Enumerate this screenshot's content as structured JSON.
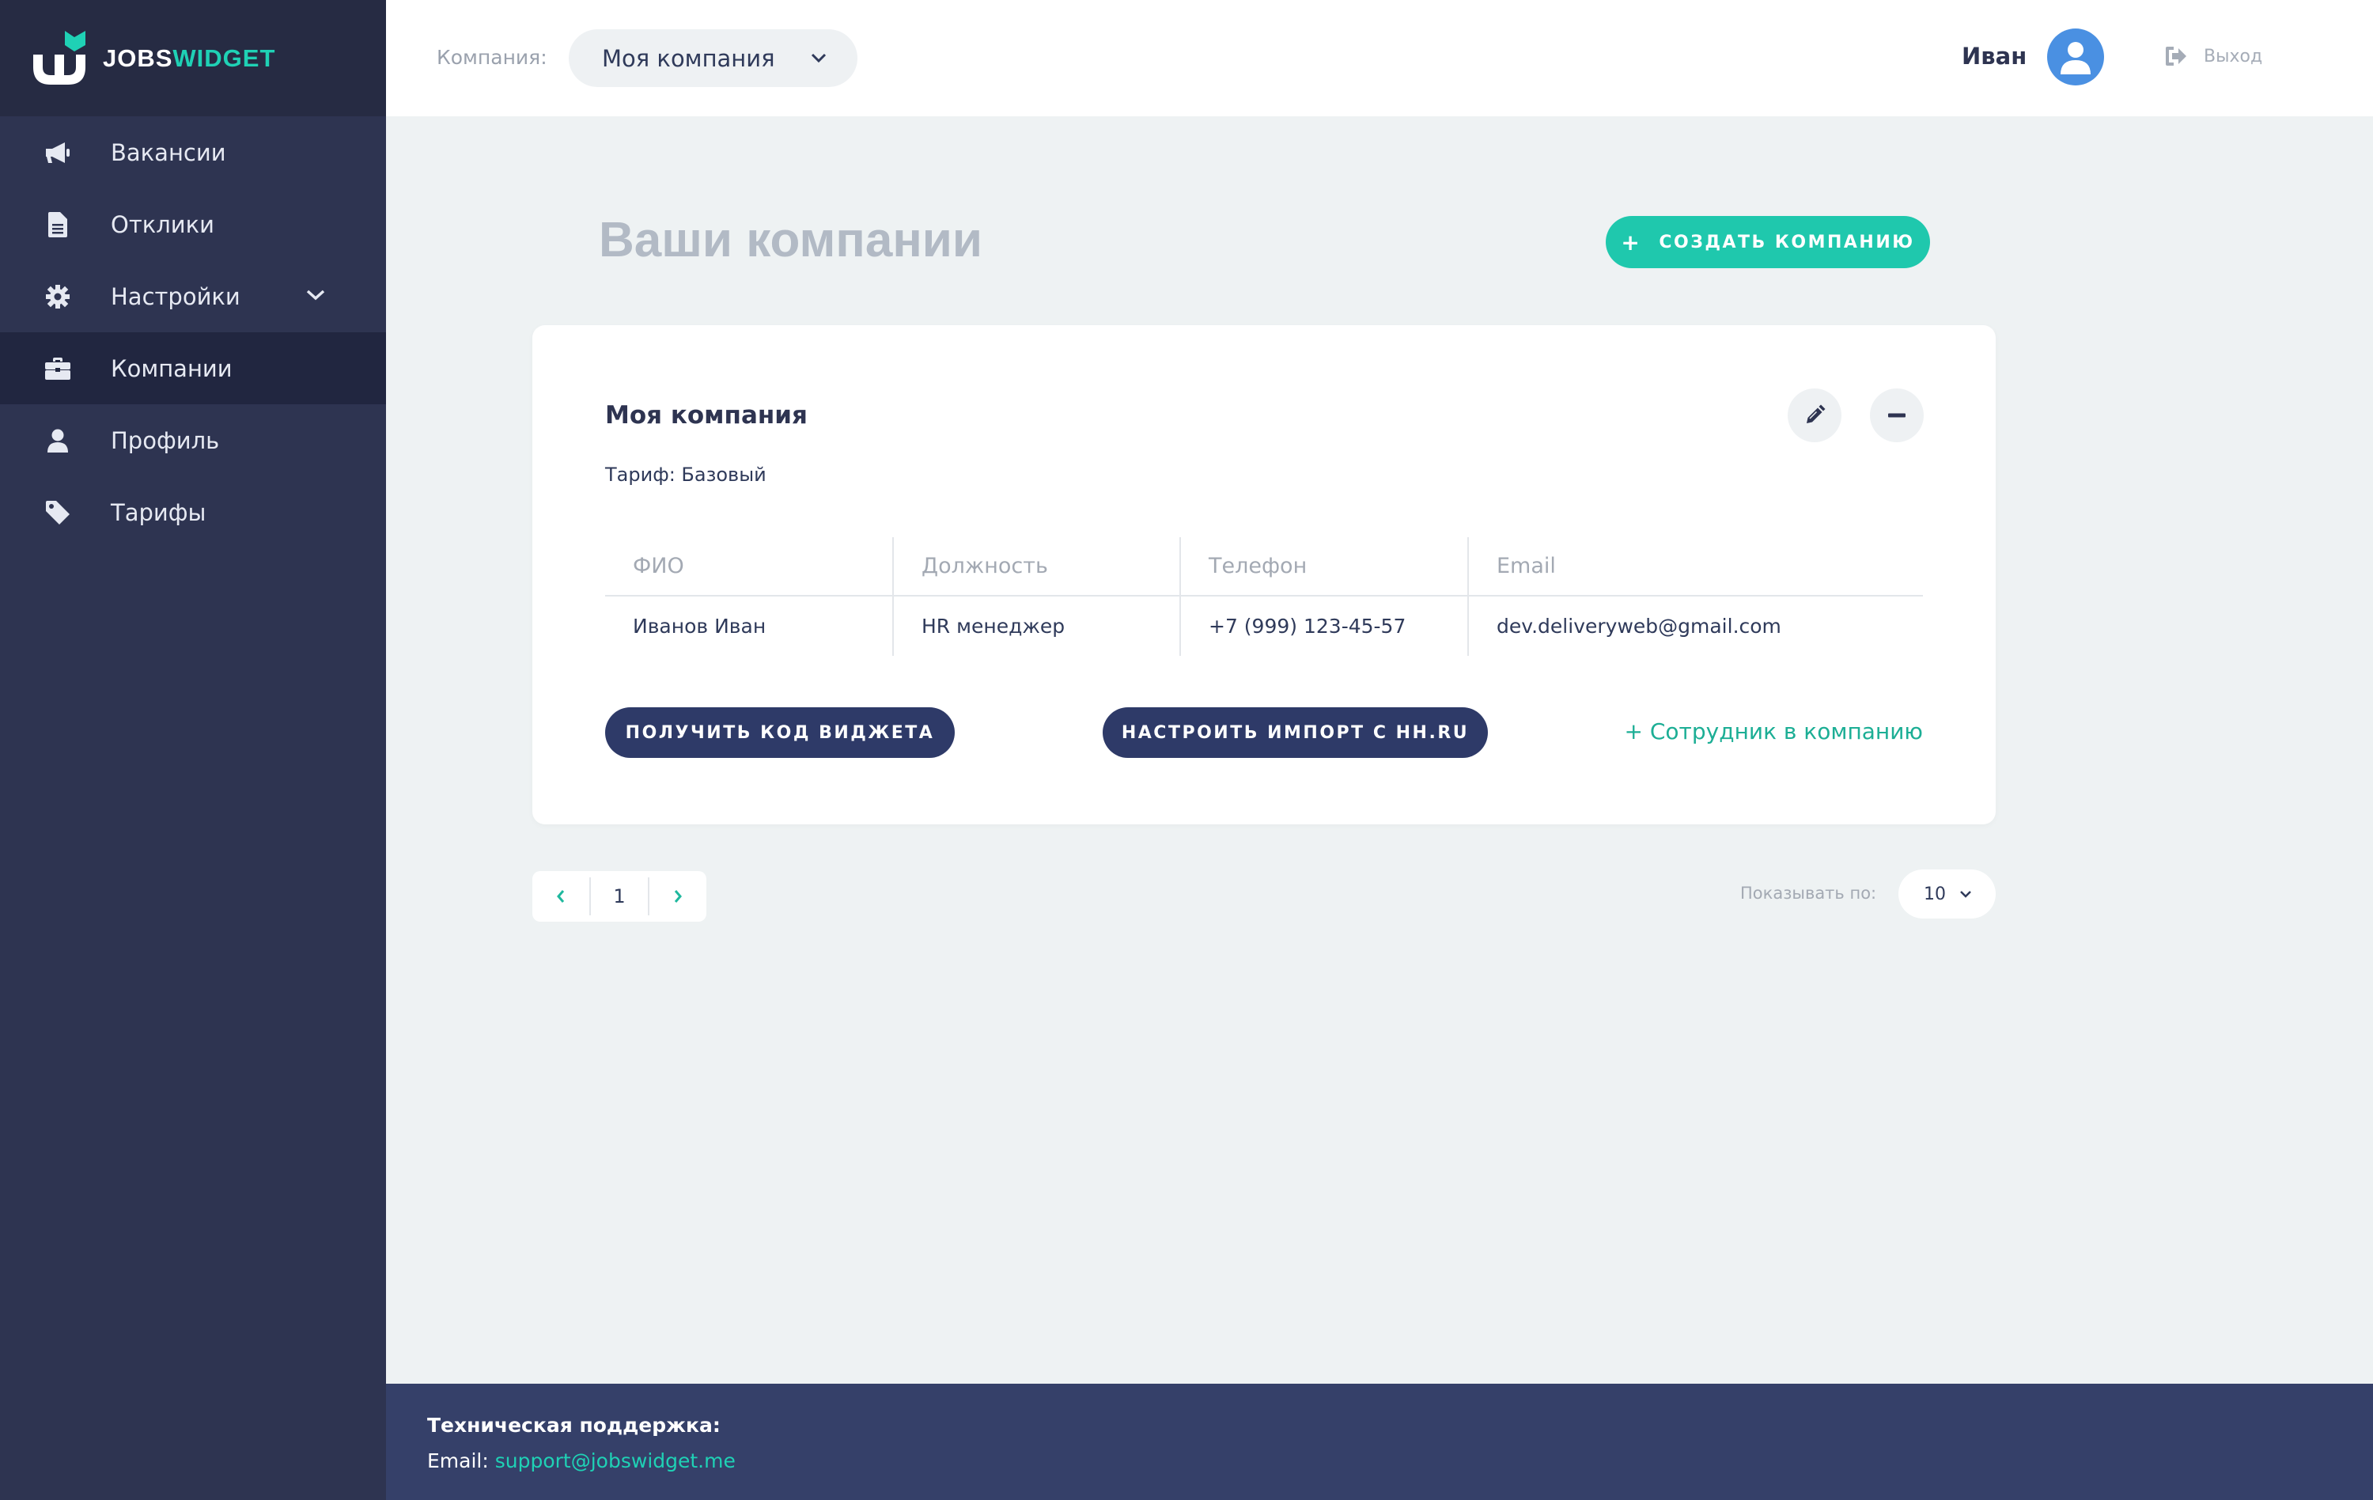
{
  "brand": {
    "part1": "JOBS",
    "part2": "WIDGET",
    "accent_color": "#1fd1b5"
  },
  "sidebar": {
    "items": [
      {
        "label": "Вакансии",
        "icon": "megaphone-icon"
      },
      {
        "label": "Отклики",
        "icon": "document-icon"
      },
      {
        "label": "Настройки",
        "icon": "gear-icon"
      },
      {
        "label": "Компании",
        "icon": "briefcase-icon",
        "active": true
      },
      {
        "label": "Профиль",
        "icon": "user-icon"
      },
      {
        "label": "Тарифы",
        "icon": "tag-icon"
      }
    ]
  },
  "header": {
    "company_label": "Компания:",
    "company_selected": "Моя компания",
    "user_name": "Иван",
    "logout_label": "Выход"
  },
  "main": {
    "title": "Ваши компании",
    "create_button": "СОЗДАТЬ КОМПАНИЮ",
    "company_card": {
      "name": "Моя компания",
      "tariff": "Тариф: Базовый",
      "columns": [
        "ФИО",
        "Должность",
        "Телефон",
        "Email"
      ],
      "rows": [
        [
          "Иванов Иван",
          "HR менеджер",
          "+7 (999) 123-45-57",
          "dev.deliveryweb@gmail.com"
        ]
      ],
      "widget_button": "ПОЛУЧИТЬ КОД ВИДЖЕТА",
      "import_button": "НАСТРОИТЬ ИМПОРТ С HH.RU",
      "add_employee": "+ Сотрудник в компанию"
    },
    "pagination": {
      "current_page": "1"
    },
    "per_page_label": "Показывать по:",
    "per_page_value": "10"
  },
  "footer": {
    "support_title": "Техническая поддержка:",
    "email_label": "Email:",
    "email": "support@jobswidget.me"
  }
}
